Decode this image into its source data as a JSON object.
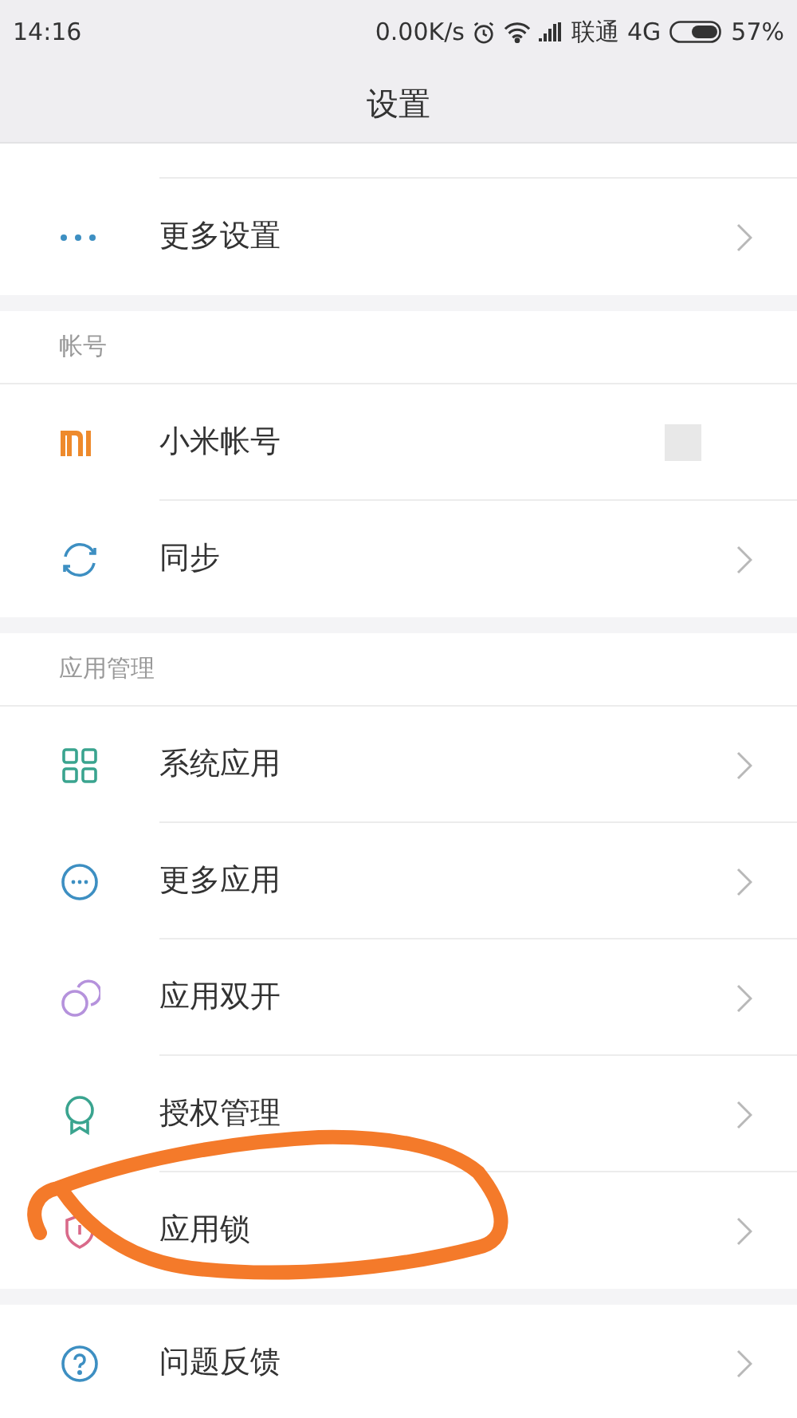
{
  "status_bar": {
    "time": "14:16",
    "speed": "0.00K/s",
    "carrier": "联通",
    "network": "4G",
    "battery": "57%"
  },
  "title": "设置",
  "sections": [
    {
      "items": [
        {
          "kind": "partial"
        },
        {
          "kind": "dots",
          "label": "更多设置",
          "chevron": true
        }
      ]
    },
    {
      "header": "帐号",
      "items": [
        {
          "kind": "mi",
          "label": "小米帐号",
          "chevron": false,
          "avatar": true
        },
        {
          "kind": "sync",
          "label": "同步",
          "chevron": true
        }
      ]
    },
    {
      "header": "应用管理",
      "items": [
        {
          "kind": "grid",
          "label": "系统应用",
          "chevron": true
        },
        {
          "kind": "more",
          "label": "更多应用",
          "chevron": true
        },
        {
          "kind": "dual",
          "label": "应用双开",
          "chevron": true
        },
        {
          "kind": "badge",
          "label": "授权管理",
          "chevron": true
        },
        {
          "kind": "shield",
          "label": "应用锁",
          "chevron": true
        }
      ]
    },
    {
      "items": [
        {
          "kind": "help",
          "label": "问题反馈",
          "chevron": true
        }
      ]
    }
  ],
  "annotation": {
    "kind": "circle"
  }
}
